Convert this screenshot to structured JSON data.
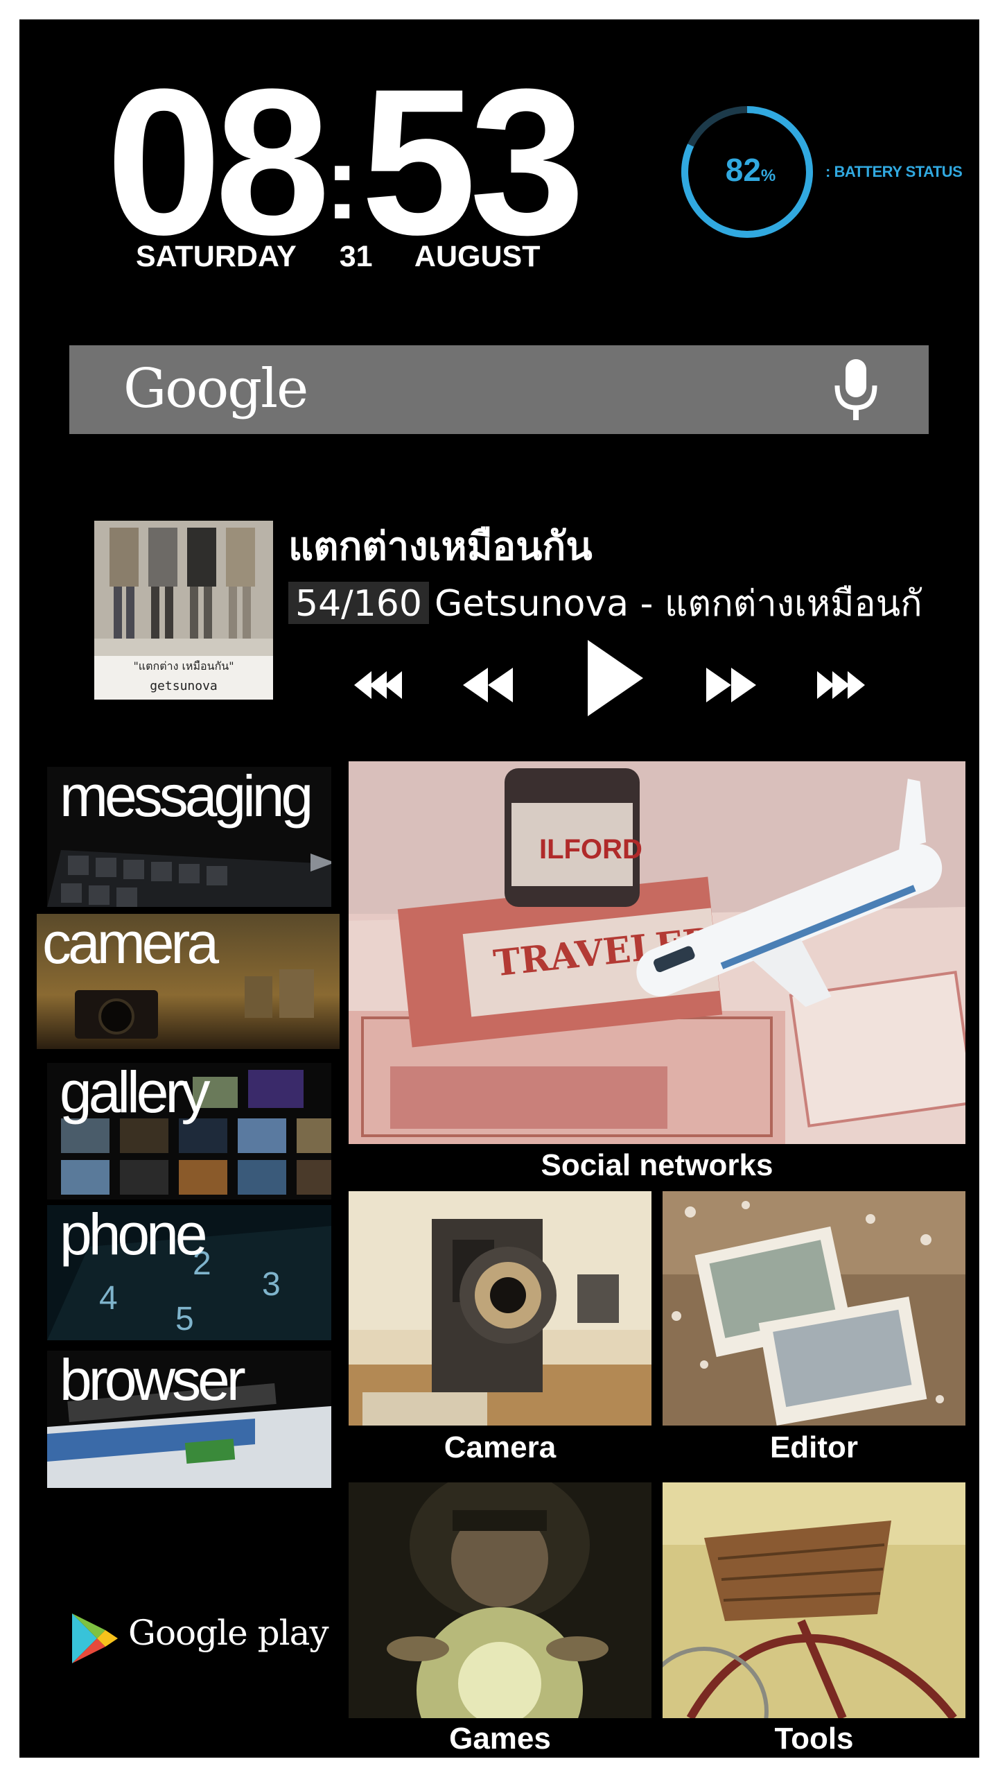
{
  "clock": {
    "hours": "08",
    "separator": ":",
    "minutes": "53",
    "day": "SATURDAY",
    "date": "31",
    "month": "AUGUST"
  },
  "battery": {
    "percent": "82",
    "percent_sign": "%",
    "label": ": BATTERY STATUS",
    "level": 0.82,
    "color": "#31a9e0"
  },
  "search": {
    "logo": "Google"
  },
  "music": {
    "album_caption": "getsunova",
    "title": "แตกต่างเหมือนกัน",
    "track_number": "54/160",
    "track_name": "Getsunova - แตกต่างเหมือนกัน"
  },
  "live_tiles": [
    {
      "label": "messaging"
    },
    {
      "label": "camera"
    },
    {
      "label": "gallery"
    },
    {
      "label": "phone"
    },
    {
      "label": "browser"
    }
  ],
  "store": {
    "label": "Google play"
  },
  "photo_tiles": [
    {
      "caption": "Social networks"
    },
    {
      "caption": "Camera"
    },
    {
      "caption": "Editor"
    },
    {
      "caption": "Games"
    },
    {
      "caption": "Tools"
    }
  ]
}
